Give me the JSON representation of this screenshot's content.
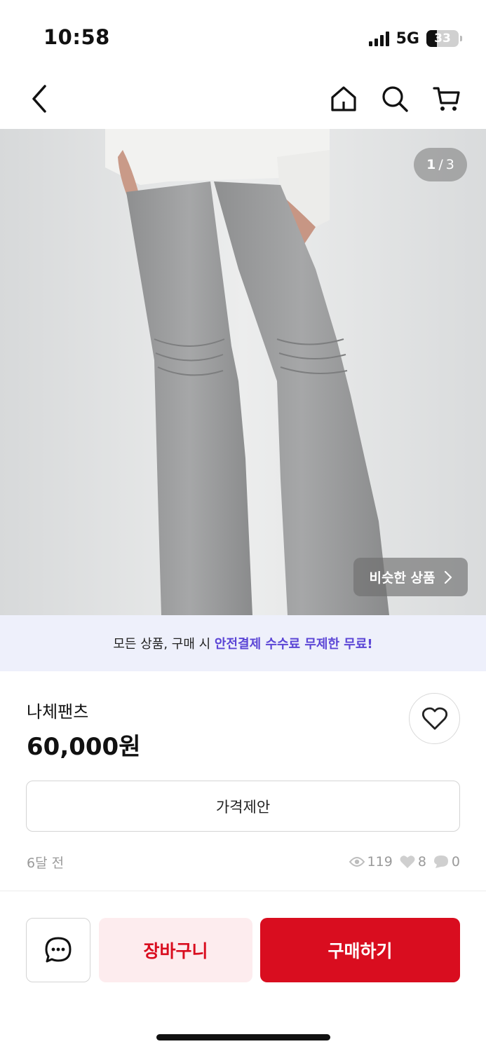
{
  "status_bar": {
    "time": "10:58",
    "network": "5G",
    "battery": "33",
    "battery_level": 0.33
  },
  "nav": {
    "back_icon": "chevron-left-icon",
    "home_icon": "home-icon",
    "search_icon": "search-icon",
    "cart_icon": "cart-icon"
  },
  "gallery": {
    "current": "1",
    "separator": "/",
    "total": "3",
    "similar_label": "비슷한 상품",
    "similar_icon": "chevron-right-icon"
  },
  "promo": {
    "prefix": "모든 상품, 구매 시 ",
    "highlight": "안전결제 수수료 무제한 무료!",
    "highlight_color": "#5b45d6"
  },
  "product": {
    "name": "나체팬츠",
    "price": "60,000원",
    "like_icon": "heart-outline-icon"
  },
  "offer_button": "가격제안",
  "meta": {
    "posted": "6달 전",
    "views": "119",
    "likes": "8",
    "comments": "0"
  },
  "actions": {
    "chat_icon": "chat-bubble-icon",
    "cart_label": "장바구니",
    "buy_label": "구매하기",
    "accent_color": "#d90d1f"
  }
}
